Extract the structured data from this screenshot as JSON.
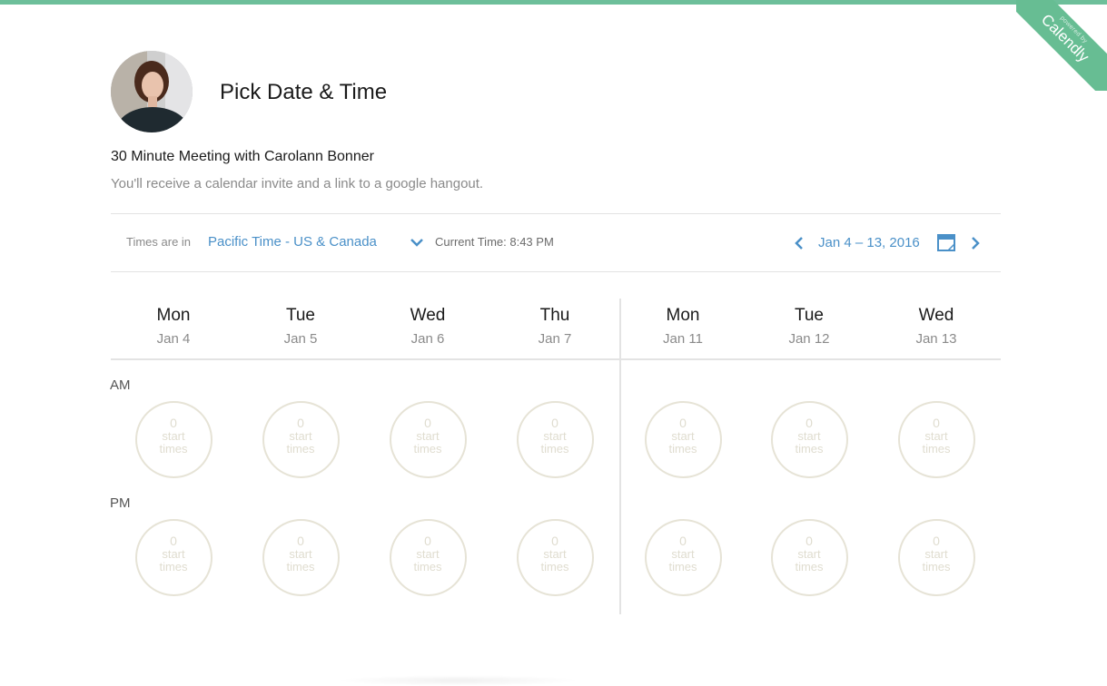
{
  "branding": {
    "powered_by": "powered by",
    "name": "Calendly",
    "accent_color": "#67bd93"
  },
  "header": {
    "title": "Pick Date & Time"
  },
  "event": {
    "title": "30 Minute Meeting with Carolann Bonner",
    "description": "You'll receive a calendar invite and a link to a google hangout."
  },
  "toolbar": {
    "tz_label": "Times are in",
    "timezone": "Pacific Time - US & Canada",
    "current_time": "Current Time: 8:43 PM",
    "date_range": "Jan 4 – 13, 2016",
    "link_color": "#4a90c8"
  },
  "days": [
    {
      "name": "Mon",
      "date": "Jan 4"
    },
    {
      "name": "Tue",
      "date": "Jan 5"
    },
    {
      "name": "Wed",
      "date": "Jan 6"
    },
    {
      "name": "Thu",
      "date": "Jan 7"
    },
    {
      "name": "Mon",
      "date": "Jan 11"
    },
    {
      "name": "Tue",
      "date": "Jan 12"
    },
    {
      "name": "Wed",
      "date": "Jan 13"
    }
  ],
  "periods": {
    "am": "AM",
    "pm": "PM"
  },
  "slots": {
    "am": [
      "0",
      "0",
      "0",
      "0",
      "0",
      "0",
      "0"
    ],
    "pm": [
      "0",
      "0",
      "0",
      "0",
      "0",
      "0",
      "0"
    ],
    "label_line1": "start",
    "label_line2": "times"
  }
}
